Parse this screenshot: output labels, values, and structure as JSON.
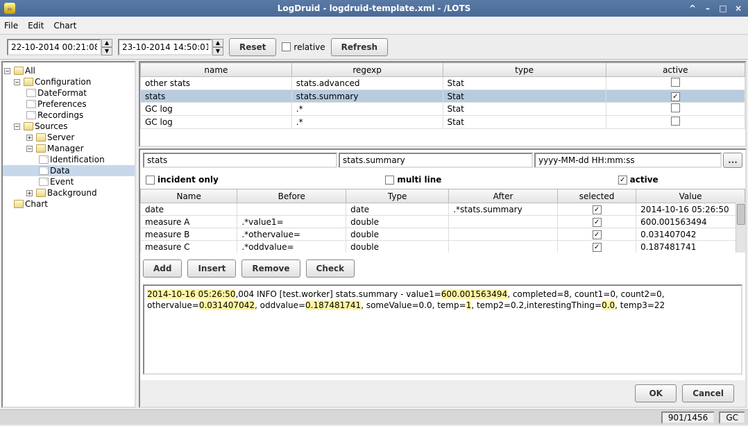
{
  "window": {
    "title": "LogDruid - logdruid-template.xml - /LOTS"
  },
  "menu": {
    "file": "File",
    "edit": "Edit",
    "chart": "Chart"
  },
  "toolbar": {
    "date_from": "22-10-2014 00:21:08",
    "date_to": "23-10-2014 14:50:01",
    "reset": "Reset",
    "relative": "relative",
    "refresh": "Refresh"
  },
  "tree": {
    "all": "All",
    "config": "Configuration",
    "dateformat": "DateFormat",
    "prefs": "Preferences",
    "recordings": "Recordings",
    "sources": "Sources",
    "server": "Server",
    "manager": "Manager",
    "identification": "Identification",
    "data": "Data",
    "event": "Event",
    "background": "Background",
    "chart": "Chart"
  },
  "top_table": {
    "h_name": "name",
    "h_regexp": "regexp",
    "h_type": "type",
    "h_active": "active",
    "rows": [
      {
        "name": "other stats",
        "regexp": "stats.advanced",
        "type": "Stat",
        "active": ""
      },
      {
        "name": "stats",
        "regexp": "stats.summary",
        "type": "Stat",
        "active": "✓"
      },
      {
        "name": "GC log",
        "regexp": ".*",
        "type": "Stat",
        "active": ""
      },
      {
        "name": "GC log",
        "regexp": ".*",
        "type": "Stat",
        "active": ""
      }
    ]
  },
  "fields": {
    "name": "stats",
    "regex": "stats.summary",
    "datefmt": "yyyy-MM-dd HH:mm:ss",
    "btn": "..."
  },
  "checks": {
    "incident": "incident only",
    "multiline": "multi line",
    "active": "active",
    "active_checked": "✓"
  },
  "fields_table": {
    "h_name": "Name",
    "h_before": "Before",
    "h_type": "Type",
    "h_after": "After",
    "h_selected": "selected",
    "h_value": "Value",
    "rows": [
      {
        "name": "date",
        "before": "",
        "type": "date",
        "after": ".*stats.summary",
        "sel": "✓",
        "value": "2014-10-16 05:26:50"
      },
      {
        "name": "measure A",
        "before": ".*value1=",
        "type": "double",
        "after": "",
        "sel": "✓",
        "value": "600.001563494"
      },
      {
        "name": "measure B",
        "before": ".*othervalue=",
        "type": "double",
        "after": "",
        "sel": "✓",
        "value": "0.031407042"
      },
      {
        "name": "measure C",
        "before": ".*oddvalue=",
        "type": "double",
        "after": "",
        "sel": "✓",
        "value": "0.187481741"
      }
    ]
  },
  "buttons": {
    "add": "Add",
    "insert": "Insert",
    "remove": "Remove",
    "check": "Check"
  },
  "log": {
    "t0": "2014-10-16 05:26:50",
    "t1": ",004 INFO  [test.worker] stats.summary  - value1=",
    "t2": "600.001563494",
    "t3": ", completed=8, count1=0, count2=0, othervalue=",
    "t4": "0.031407042",
    "t5": ", oddvalue=",
    "t6": "0.187481741",
    "t7": ", someValue=0.0, temp=",
    "t8": "1",
    "t9": ", temp2=0.2,interestingThing=",
    "t10": "0.0",
    "t11": ", temp3=22"
  },
  "dialog": {
    "ok": "OK",
    "cancel": "Cancel"
  },
  "status": {
    "mem": "901/1456",
    "gc": "GC"
  }
}
